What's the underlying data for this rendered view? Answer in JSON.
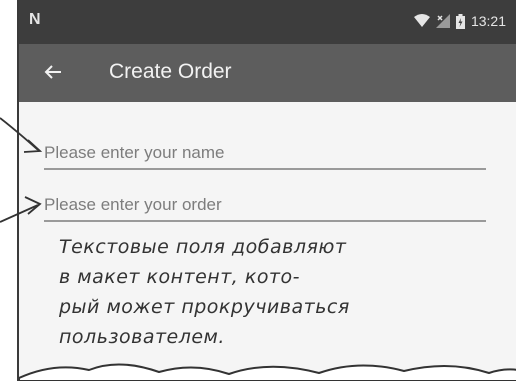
{
  "status_bar": {
    "carrier_icon": "n-icon",
    "carrier": "N",
    "time": "13:21"
  },
  "app_bar": {
    "title": "Create Order"
  },
  "form": {
    "name_placeholder": "Please enter your name",
    "order_placeholder": "Please enter your order"
  },
  "annotation": {
    "line1": "Текстовые поля добавляют",
    "line2": "в макет контент, кото-",
    "line3": "рый может прокручиваться",
    "line4": "пользователем."
  }
}
